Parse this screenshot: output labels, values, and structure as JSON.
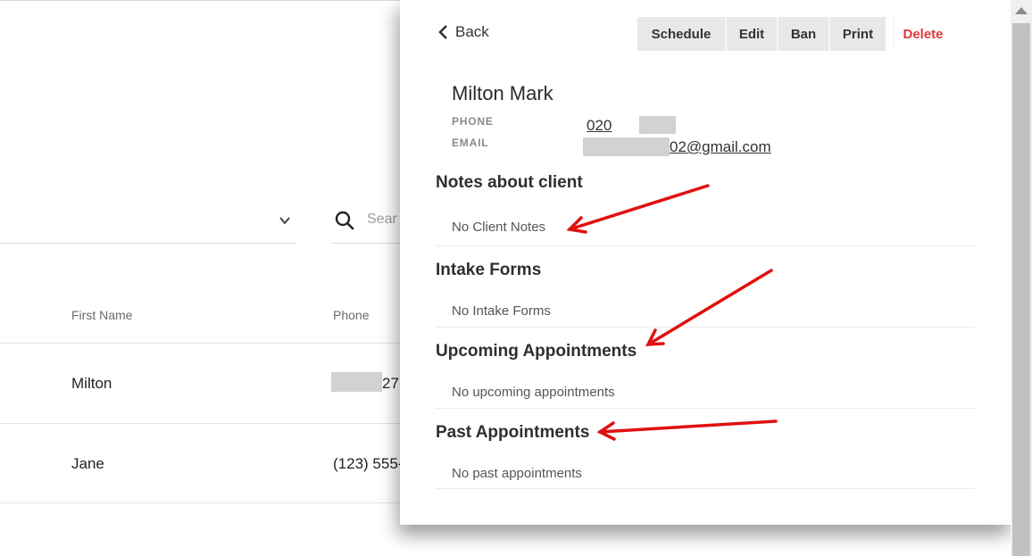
{
  "list": {
    "search_placeholder": "Sear",
    "columns": {
      "first_name": "First Name",
      "phone": "Phone"
    },
    "rows": [
      {
        "first_name": "Milton",
        "phone": "27"
      },
      {
        "first_name": "Jane",
        "phone": "(123) 555-"
      }
    ]
  },
  "panel": {
    "back_label": "Back",
    "toolbar": {
      "schedule": "Schedule",
      "edit": "Edit",
      "ban": "Ban",
      "print": "Print",
      "delete": "Delete",
      "delete_color": "#e03838"
    },
    "client": {
      "name": "Milton Mark",
      "phone_label": "PHONE",
      "phone_value": "020",
      "email_label": "EMAIL",
      "email_value": "02@gmail.com"
    },
    "sections": {
      "notes": {
        "title": "Notes about client",
        "empty": "No Client Notes"
      },
      "intake": {
        "title": "Intake Forms",
        "empty": "No Intake Forms"
      },
      "upcoming": {
        "title": "Upcoming Appointments",
        "empty": "No upcoming appointments"
      },
      "past": {
        "title": "Past Appointments",
        "empty": "No past appointments"
      }
    }
  },
  "annotation_color": "#e01010"
}
